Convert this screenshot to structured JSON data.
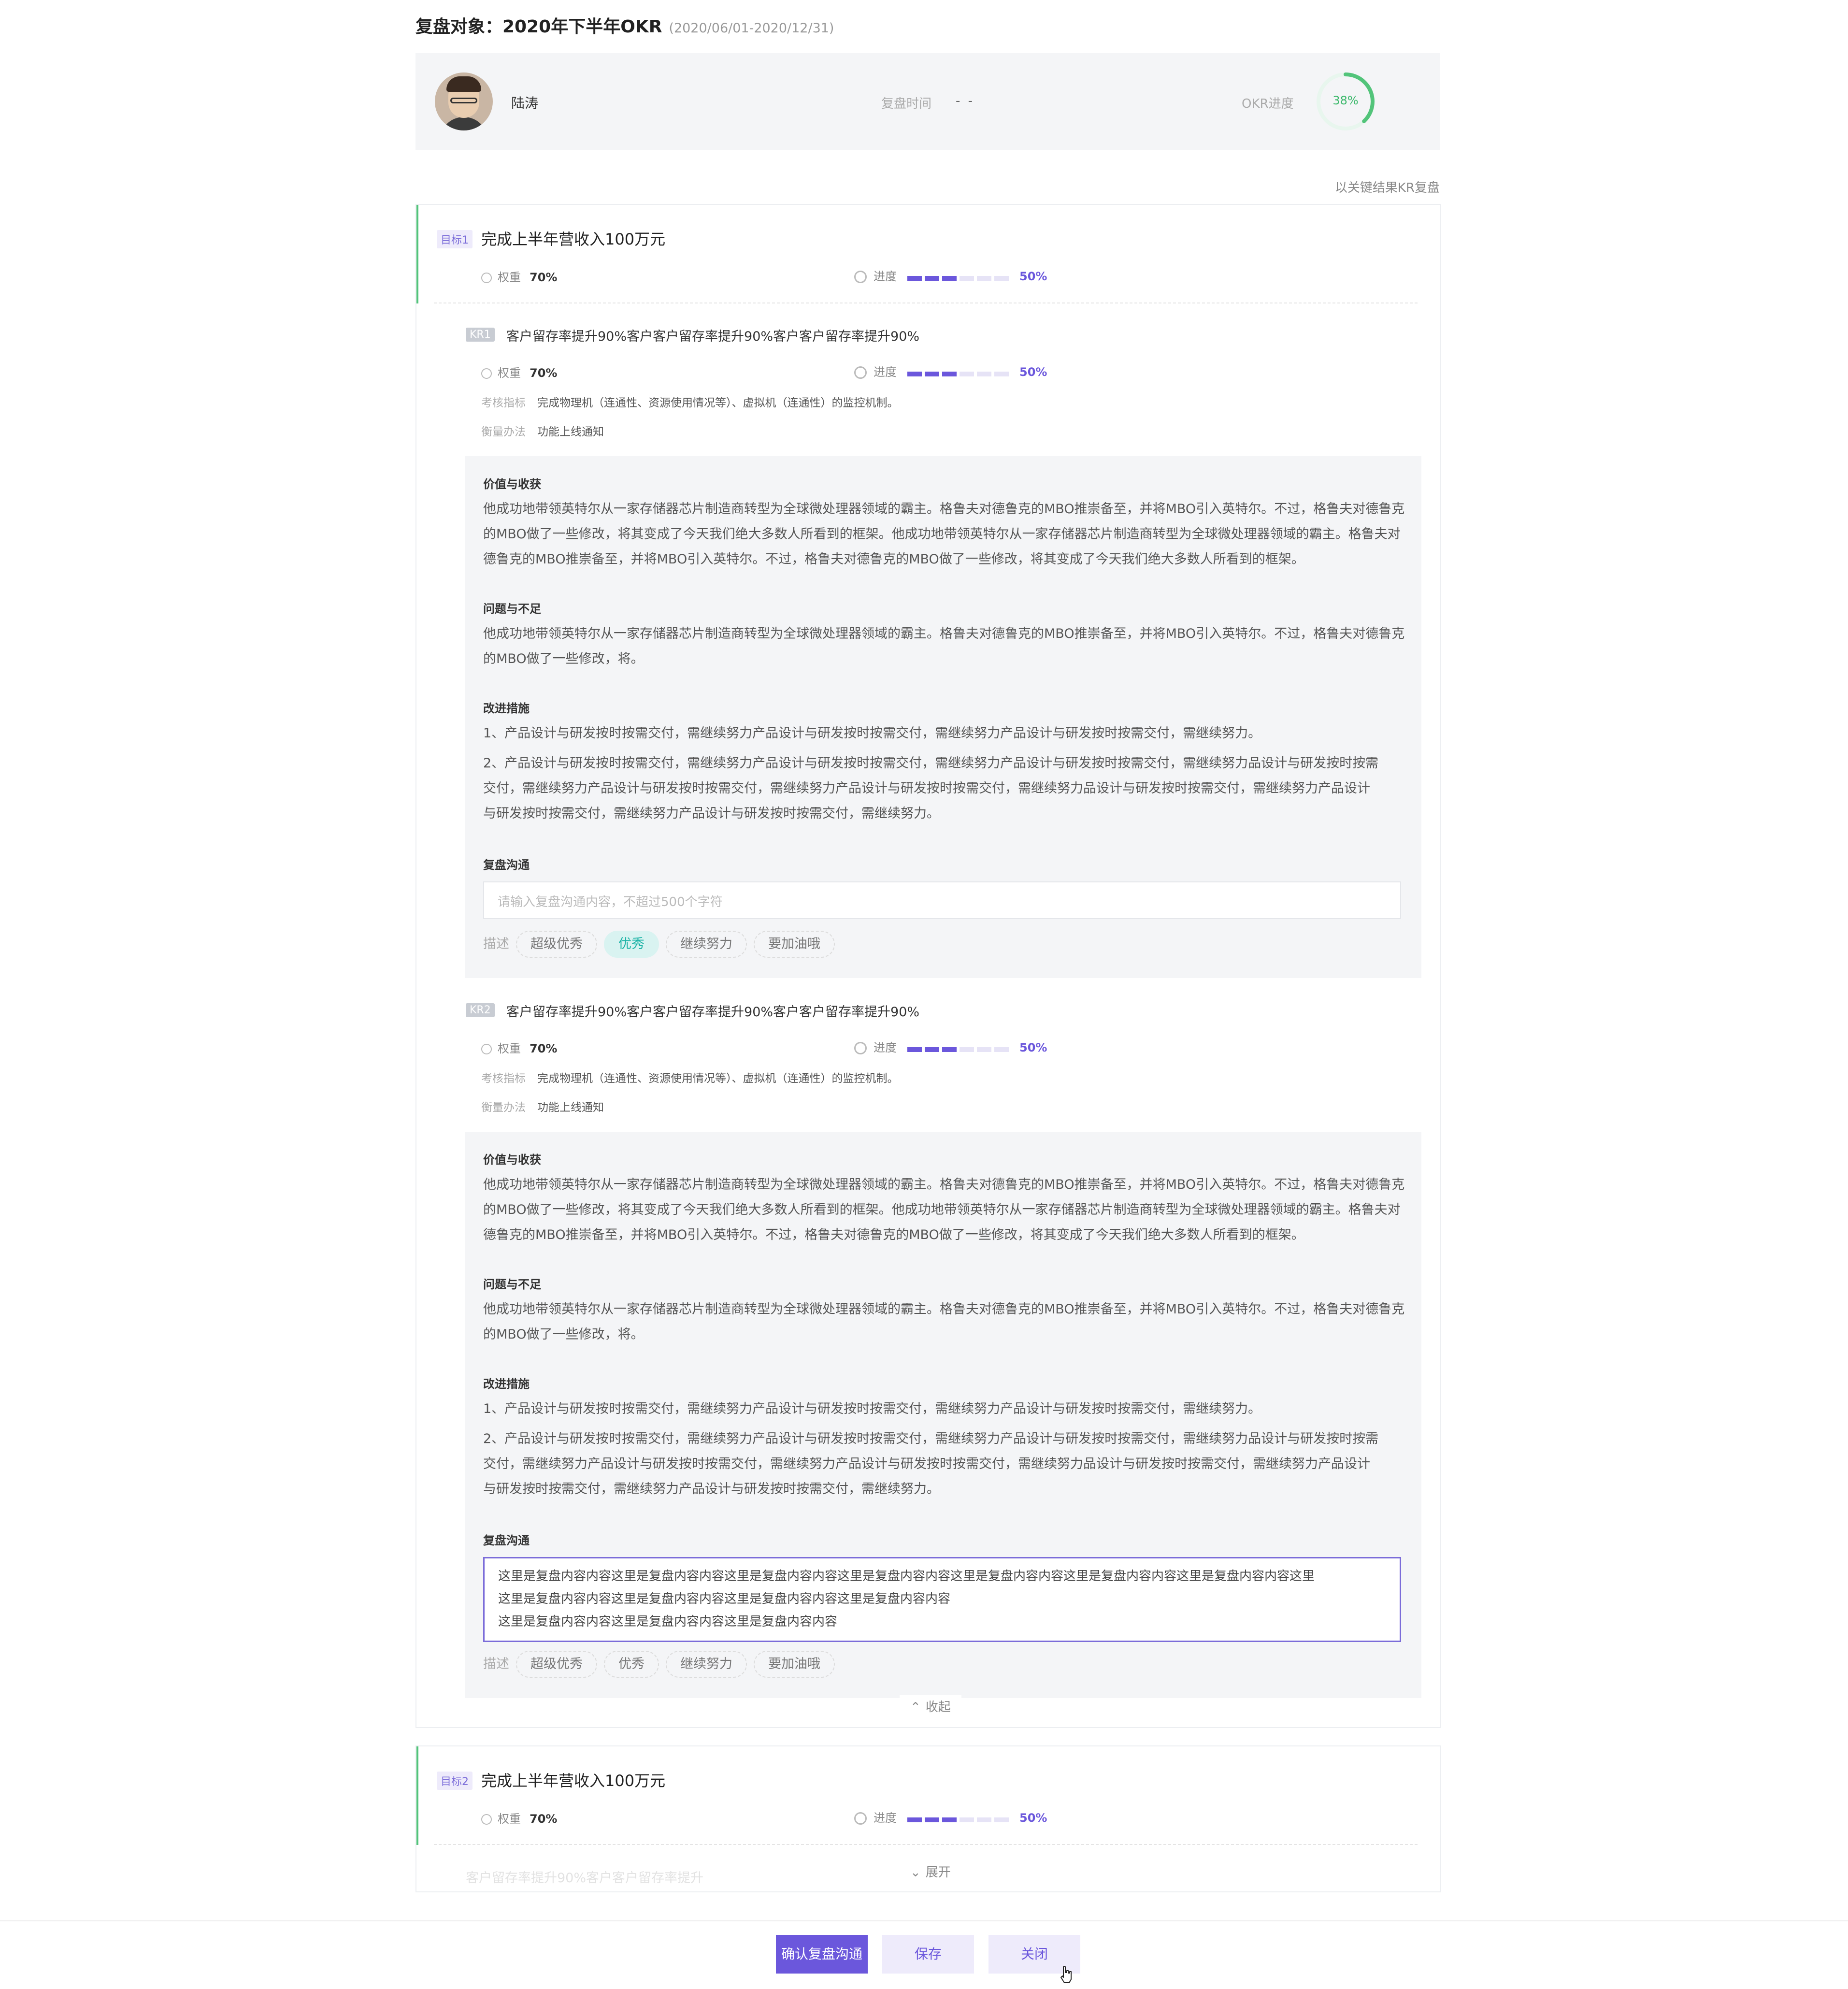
{
  "header": {
    "title": "复盘对象：2020年下半年OKR",
    "range": "(2020/06/01-2020/12/31)"
  },
  "user": {
    "name": "陆涛",
    "review_time_label": "复盘时间",
    "review_time_value": "- -",
    "okr_progress_label": "OKR进度",
    "okr_progress_value": "38%",
    "okr_progress_fraction": 0.38
  },
  "by_kr_link": "以关键结果KR复盘",
  "labels": {
    "weight": "权重",
    "progress": "进度",
    "indicator": "考核指标",
    "method": "衡量办法",
    "value": "价值与收获",
    "problem": "问题与不足",
    "improve": "改进措施",
    "comm": "复盘沟通",
    "desc": "描述"
  },
  "objective1": {
    "tag": "目标1",
    "title": "完成上半年营收入100万元",
    "weight": "70%",
    "progress": "50%",
    "progress_fraction": 0.5
  },
  "kr1": {
    "tag": "KR1",
    "title": "客户留存率提升90%客户客户留存率提升90%客户客户留存率提升90%",
    "weight": "70%",
    "progress": "50%",
    "indicator": "完成物理机（连通性、资源使用情况等）、虚拟机（连通性）的监控机制。",
    "method": "功能上线通知",
    "value_text": "他成功地带领英特尔从一家存储器芯片制造商转型为全球微处理器领域的霸主。格鲁夫对德鲁克的MBO推崇备至，并将MBO引入英特尔。不过，格鲁夫对德鲁克的MBO做了一些修改，将其变成了今天我们绝大多数人所看到的框架。他成功地带领英特尔从一家存储器芯片制造商转型为全球微处理器领域的霸主。格鲁夫对德鲁克的MBO推崇备至，并将MBO引入英特尔。不过，格鲁夫对德鲁克的MBO做了一些修改，将其变成了今天我们绝大多数人所看到的框架。",
    "problem_text": "他成功地带领英特尔从一家存储器芯片制造商转型为全球微处理器领域的霸主。格鲁夫对德鲁克的MBO推崇备至，并将MBO引入英特尔。不过，格鲁夫对德鲁克的MBO做了一些修改，将。",
    "improve_1": "1、产品设计与研发按时按需交付，需继续努力产品设计与研发按时按需交付，需继续努力产品设计与研发按时按需交付，需继续努力。",
    "improve_2": "2、产品设计与研发按时按需交付，需继续努力产品设计与研发按时按需交付，需继续努力产品设计与研发按时按需交付，需继续努力品设计与研发按时按需交付，需继续努力产品设计与研发按时按需交付，需继续努力产品设计与研发按时按需交付，需继续努力品设计与研发按时按需交付，需继续努力产品设计与研发按时按需交付，需继续努力产品设计与研发按时按需交付，需继续努力。",
    "comm_placeholder": "请输入复盘沟通内容，不超过500个字符"
  },
  "kr2": {
    "tag": "KR2",
    "title": "客户留存率提升90%客户客户留存率提升90%客户客户留存率提升90%",
    "weight": "70%",
    "progress": "50%",
    "indicator": "完成物理机（连通性、资源使用情况等）、虚拟机（连通性）的监控机制。",
    "method": "功能上线通知",
    "value_text": "他成功地带领英特尔从一家存储器芯片制造商转型为全球微处理器领域的霸主。格鲁夫对德鲁克的MBO推崇备至，并将MBO引入英特尔。不过，格鲁夫对德鲁克的MBO做了一些修改，将其变成了今天我们绝大多数人所看到的框架。他成功地带领英特尔从一家存储器芯片制造商转型为全球微处理器领域的霸主。格鲁夫对德鲁克的MBO推崇备至，并将MBO引入英特尔。不过，格鲁夫对德鲁克的MBO做了一些修改，将其变成了今天我们绝大多数人所看到的框架。",
    "problem_text": "他成功地带领英特尔从一家存储器芯片制造商转型为全球微处理器领域的霸主。格鲁夫对德鲁克的MBO推崇备至，并将MBO引入英特尔。不过，格鲁夫对德鲁克的MBO做了一些修改，将。",
    "improve_1": "1、产品设计与研发按时按需交付，需继续努力产品设计与研发按时按需交付，需继续努力产品设计与研发按时按需交付，需继续努力。",
    "improve_2": "2、产品设计与研发按时按需交付，需继续努力产品设计与研发按时按需交付，需继续努力产品设计与研发按时按需交付，需继续努力品设计与研发按时按需交付，需继续努力产品设计与研发按时按需交付，需继续努力产品设计与研发按时按需交付，需继续努力品设计与研发按时按需交付，需继续努力产品设计与研发按时按需交付，需继续努力产品设计与研发按时按需交付，需继续努力。",
    "comm_line1": "这里是复盘内容内容这里是复盘内容内容这里是复盘内容内容这里是复盘内容内容这里是复盘内容内容这里是复盘内容内容这里是复盘内容内容这里",
    "comm_line2": "这里是复盘内容内容这里是复盘内容内容这里是复盘内容内容这里是复盘内容内容",
    "comm_line3": "这里是复盘内容内容这里是复盘内容内容这里是复盘内容内容"
  },
  "chips": [
    "超级优秀",
    "优秀",
    "继续努力",
    "要加油哦"
  ],
  "chips_selected_kr1": "优秀",
  "collapse_label": "收起",
  "objective2": {
    "tag": "目标2",
    "title": "完成上半年营收入100万元",
    "weight": "70%",
    "progress": "50%",
    "progress_fraction": 0.5,
    "faded_kr_title": "客户留存率提升90%客户客户留存率提升"
  },
  "expand_label": "展开",
  "buttons": {
    "confirm": "确认复盘沟通",
    "save": "保存",
    "close": "关闭"
  },
  "colors": {
    "accent": "#6b57dc",
    "green": "#52c47a",
    "selected_chip": "#1bb3a6"
  }
}
